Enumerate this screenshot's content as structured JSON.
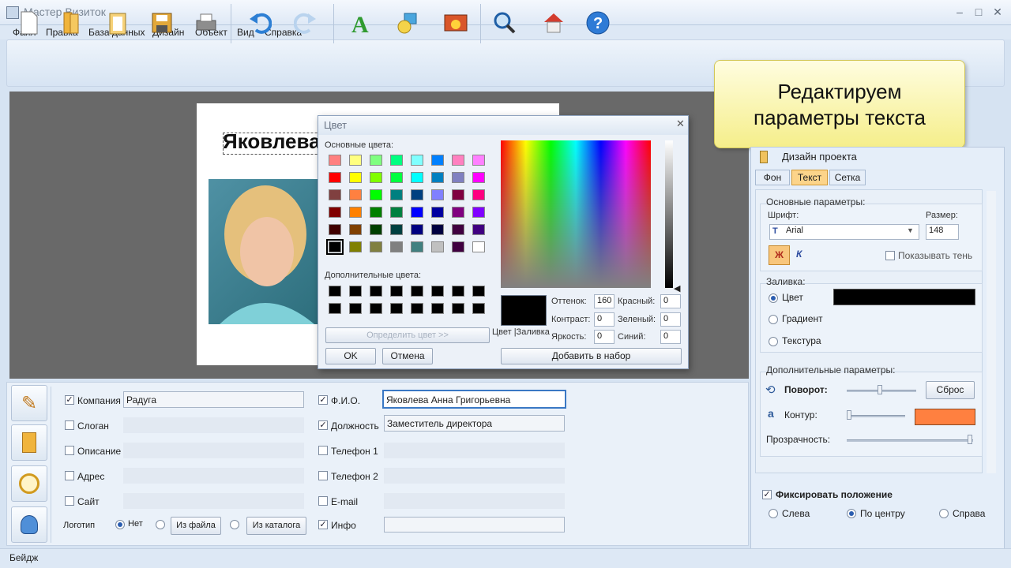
{
  "window": {
    "title": "Мастер Визиток",
    "minimize": "–",
    "maximize": "□",
    "close": "✕"
  },
  "menu": [
    "Файл",
    "Правка",
    "База данных",
    "Дизайн",
    "Объект",
    "Вид",
    "Справка"
  ],
  "toolbar_icons": [
    "new-file-icon",
    "open-folder-icon",
    "clipboard-icon",
    "save-icon",
    "print-icon",
    "undo-icon",
    "redo-icon",
    "text-a-icon",
    "shapes-icon",
    "image-icon",
    "zoom-icon",
    "home-icon",
    "help-icon"
  ],
  "card": {
    "name_text": "Яковлева"
  },
  "color_dialog": {
    "title": "Цвет",
    "basic_label": "Основные цвета:",
    "custom_label": "Дополнительные цвета:",
    "define_button": "Определить цвет >>",
    "ok": "OK",
    "cancel": "Отмена",
    "add_button": "Добавить в набор",
    "color_fill_label": "Цвет |Заливка",
    "hue_label": "Оттенок:",
    "hue": "160",
    "sat_label": "Контраст:",
    "sat": "0",
    "lum_label": "Яркость:",
    "lum": "0",
    "red_label": "Красный:",
    "red": "0",
    "green_label": "Зеленый:",
    "green": "0",
    "blue_label": "Синий:",
    "blue": "0",
    "basic_colors": [
      "#ff8080",
      "#ffff80",
      "#80ff80",
      "#00ff80",
      "#80ffff",
      "#0080ff",
      "#ff80c0",
      "#ff80ff",
      "#ff0000",
      "#ffff00",
      "#80ff00",
      "#00ff40",
      "#00ffff",
      "#0080c0",
      "#8080c0",
      "#ff00ff",
      "#804040",
      "#ff8040",
      "#00ff00",
      "#008080",
      "#004080",
      "#8080ff",
      "#800040",
      "#ff0080",
      "#800000",
      "#ff8000",
      "#008000",
      "#008040",
      "#0000ff",
      "#0000a0",
      "#800080",
      "#8000ff",
      "#400000",
      "#804000",
      "#004000",
      "#004040",
      "#000080",
      "#000040",
      "#400040",
      "#400080",
      "#000000",
      "#808000",
      "#808040",
      "#808080",
      "#408080",
      "#c0c0c0",
      "#400040",
      "#ffffff"
    ],
    "custom_colors": [
      "#000000",
      "#000000",
      "#000000",
      "#000000",
      "#000000",
      "#000000",
      "#000000",
      "#000000",
      "#000000",
      "#000000",
      "#000000",
      "#000000",
      "#000000",
      "#000000",
      "#000000",
      "#000000"
    ]
  },
  "callout": {
    "line1": "Редактируем",
    "line2": "параметры текста"
  },
  "panel": {
    "header": "Дизайн проекта",
    "tabs": [
      "Фон",
      "Текст",
      "Сетка"
    ],
    "basic_title": "Основные параметры:",
    "font_label": "Шрифт:",
    "font_value": "Arial",
    "size_label": "Размер:",
    "size_value": "148",
    "bold": "Ж",
    "italic": "К",
    "shadow_label": "Показывать тень",
    "fill_title": "Заливка:",
    "fill_color": "Цвет",
    "fill_gradient": "Градиент",
    "fill_texture": "Текстура",
    "fill_swatch": "#000000",
    "extra_title": "Дополнительные параметры:",
    "rotate_label": "Поворот:",
    "reset_button": "Сброс",
    "contour_label": "Контур:",
    "contour_swatch": "#ff8040",
    "opacity_label": "Прозрачность:",
    "fix_label": "Фиксировать положение",
    "align_left": "Слева",
    "align_center": "По центру",
    "align_right": "Справа"
  },
  "form": {
    "left": [
      {
        "label": "Компания",
        "checked": "✓",
        "value": "Радуга"
      },
      {
        "label": "Слоган",
        "checked": "",
        "value": ""
      },
      {
        "label": "Описание",
        "checked": "",
        "value": ""
      },
      {
        "label": "Адрес",
        "checked": "",
        "value": ""
      },
      {
        "label": "Сайт",
        "checked": "",
        "value": ""
      }
    ],
    "right": [
      {
        "label": "Ф.И.О.",
        "checked": "✓",
        "value": "Яковлева Анна Григорьевна"
      },
      {
        "label": "Должность",
        "checked": "✓",
        "value": "Заместитель директора"
      },
      {
        "label": "Телефон 1",
        "checked": "",
        "value": ""
      },
      {
        "label": "Телефон 2",
        "checked": "",
        "value": ""
      },
      {
        "label": "E-mail",
        "checked": "",
        "value": ""
      },
      {
        "label": "Инфо",
        "checked": "✓",
        "value": ""
      }
    ],
    "logo_label": "Логотип",
    "logo_none": "Нет",
    "logo_file": "Из файла",
    "logo_catalog": "Из каталога"
  },
  "status": "Бейдж"
}
